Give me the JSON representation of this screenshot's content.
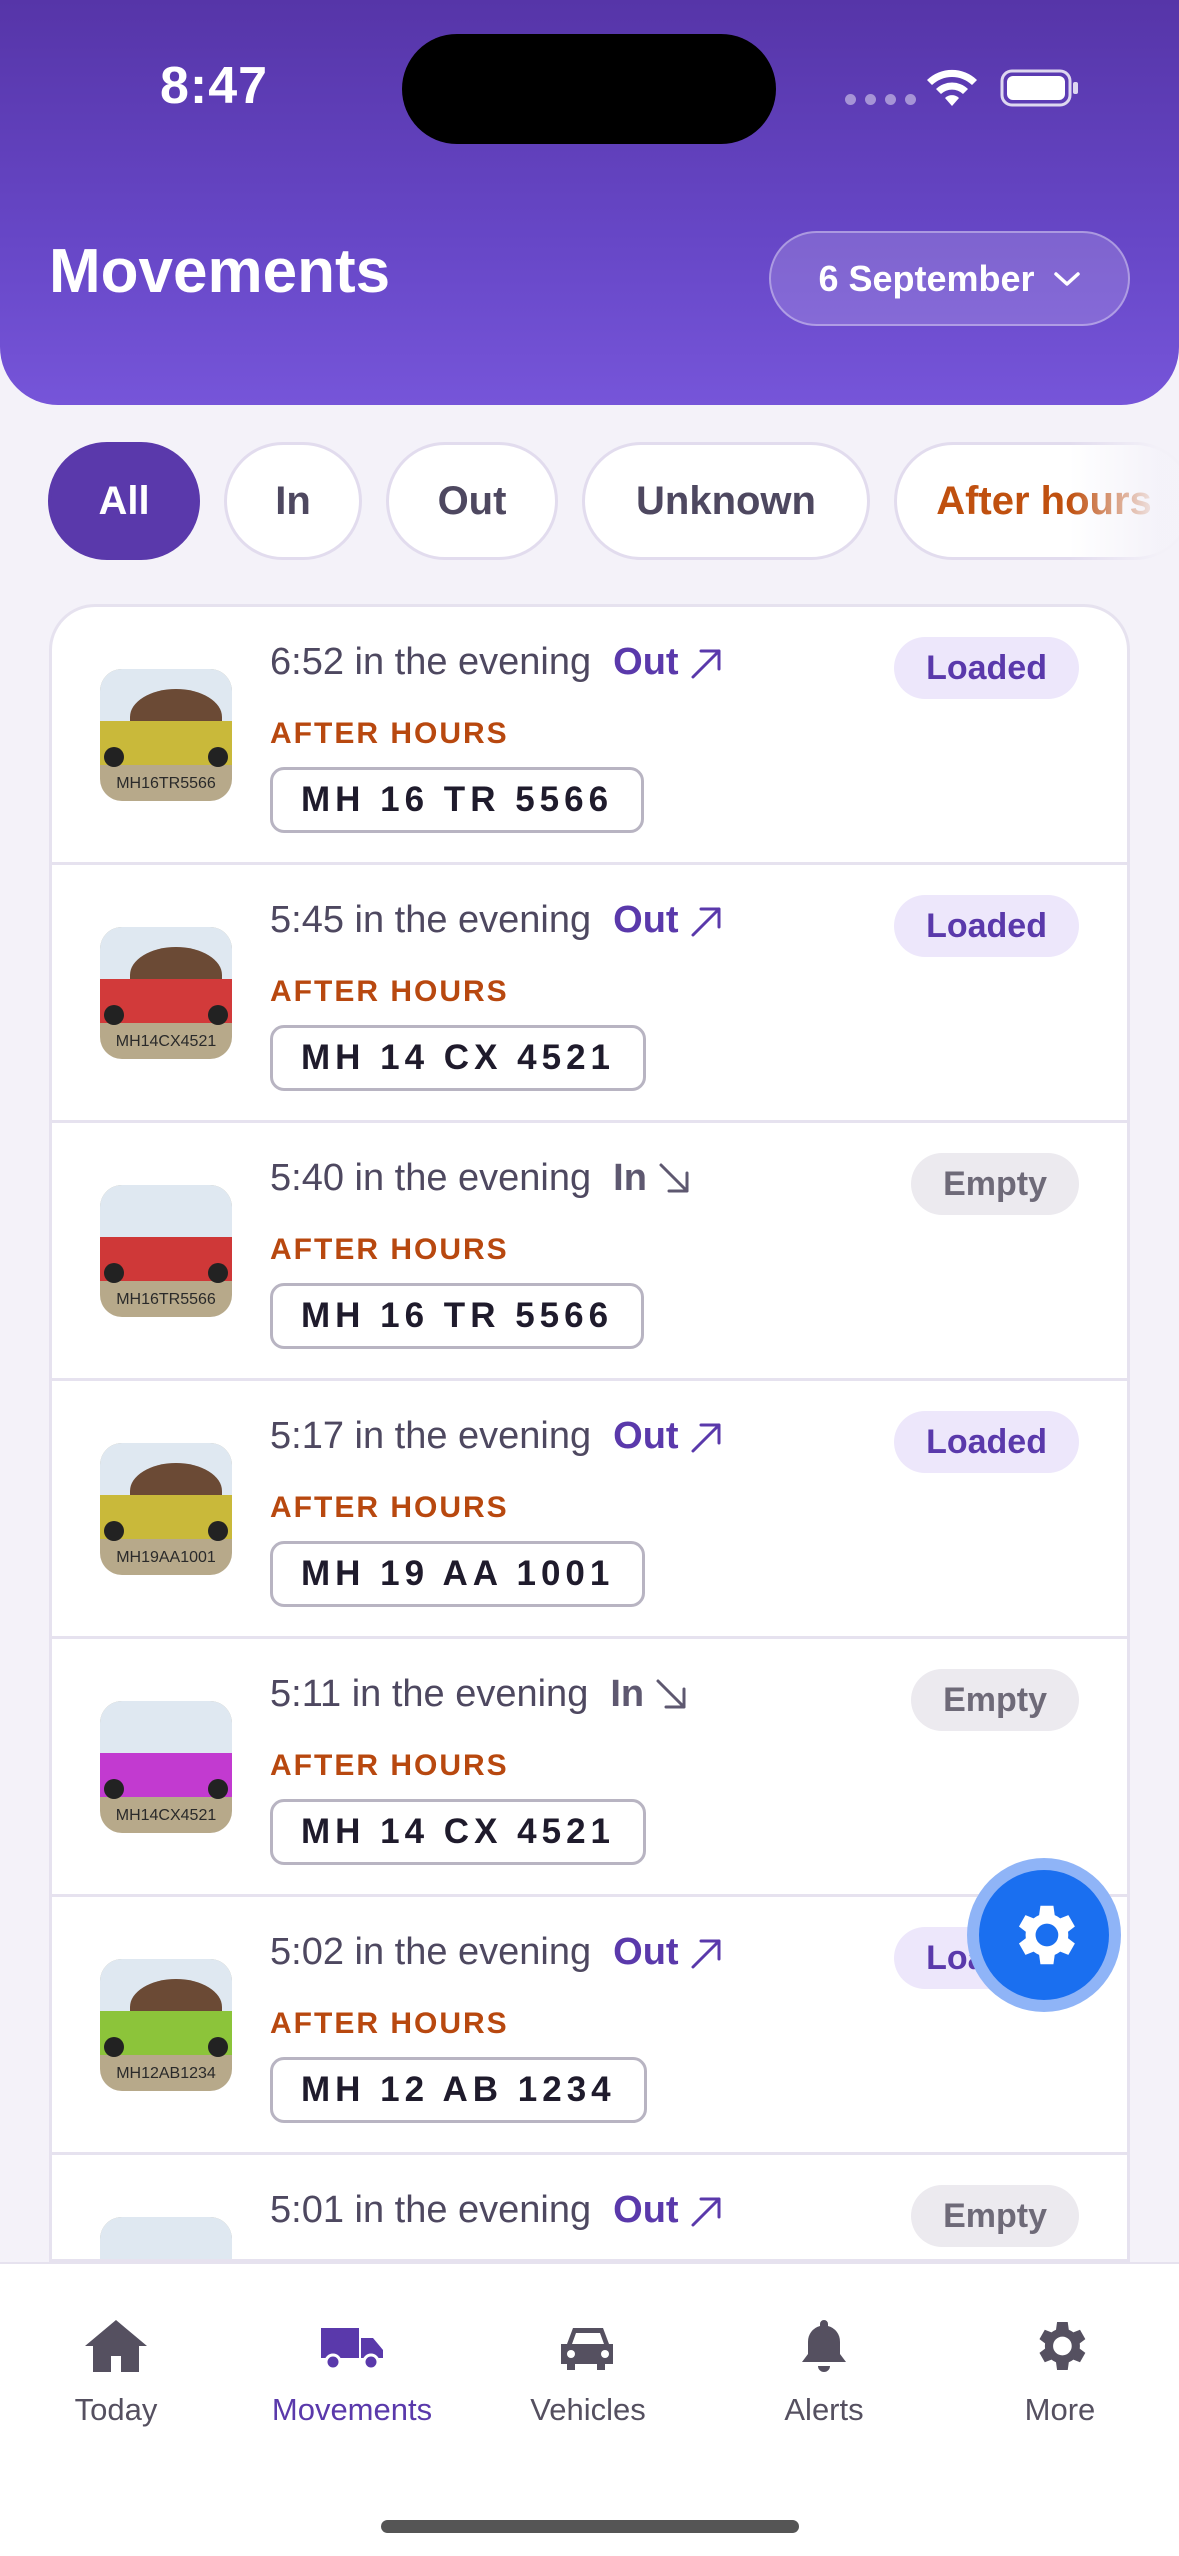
{
  "status_bar": {
    "time": "8:47"
  },
  "header": {
    "title": "Movements",
    "date_label": "6 September"
  },
  "filters": [
    {
      "label": "All",
      "active": true
    },
    {
      "label": "In",
      "active": false
    },
    {
      "label": "Out",
      "active": false
    },
    {
      "label": "Unknown",
      "active": false
    },
    {
      "label": "After hours",
      "active": false
    }
  ],
  "movements": [
    {
      "time": "6:52 in the evening",
      "direction": "Out",
      "after_hours": "AFTER HOURS",
      "plate": "MH 16 TR 5566",
      "thumb_plate": "MH16TR5566",
      "status": "Loaded",
      "truck_color": "#c9b93a",
      "has_load": true
    },
    {
      "time": "5:45 in the evening",
      "direction": "Out",
      "after_hours": "AFTER HOURS",
      "plate": "MH 14 CX 4521",
      "thumb_plate": "MH14CX4521",
      "status": "Loaded",
      "truck_color": "#d23a3a",
      "has_load": true
    },
    {
      "time": "5:40 in the evening",
      "direction": "In",
      "after_hours": "AFTER HOURS",
      "plate": "MH 16 TR 5566",
      "thumb_plate": "MH16TR5566",
      "status": "Empty",
      "truck_color": "#cf3838",
      "has_load": false
    },
    {
      "time": "5:17 in the evening",
      "direction": "Out",
      "after_hours": "AFTER HOURS",
      "plate": "MH 19 AA 1001",
      "thumb_plate": "MH19AA1001",
      "status": "Loaded",
      "truck_color": "#c9b93a",
      "has_load": true
    },
    {
      "time": "5:11 in the evening",
      "direction": "In",
      "after_hours": "AFTER HOURS",
      "plate": "MH 14 CX 4521",
      "thumb_plate": "MH14CX4521",
      "status": "Empty",
      "truck_color": "#c23ad0",
      "has_load": false
    },
    {
      "time": "5:02 in the evening",
      "direction": "Out",
      "after_hours": "AFTER HOURS",
      "plate": "MH 12 AB 1234",
      "thumb_plate": "MH12AB1234",
      "status": "Loaded",
      "truck_color": "#8cc43a",
      "has_load": true
    },
    {
      "time": "5:01 in the evening",
      "direction": "Out",
      "after_hours": "",
      "plate": "",
      "thumb_plate": "",
      "status": "Empty",
      "truck_color": "#7ac04a",
      "has_load": false
    }
  ],
  "bottom_nav": [
    {
      "label": "Today",
      "icon": "home-icon",
      "active": false
    },
    {
      "label": "Movements",
      "icon": "truck-icon",
      "active": true
    },
    {
      "label": "Vehicles",
      "icon": "car-icon",
      "active": false
    },
    {
      "label": "Alerts",
      "icon": "bell-icon",
      "active": false
    },
    {
      "label": "More",
      "icon": "gear-icon",
      "active": false
    }
  ],
  "colors": {
    "brand": "#5a39ab",
    "after_hours": "#b8480f",
    "fab": "#1a6ff0"
  }
}
